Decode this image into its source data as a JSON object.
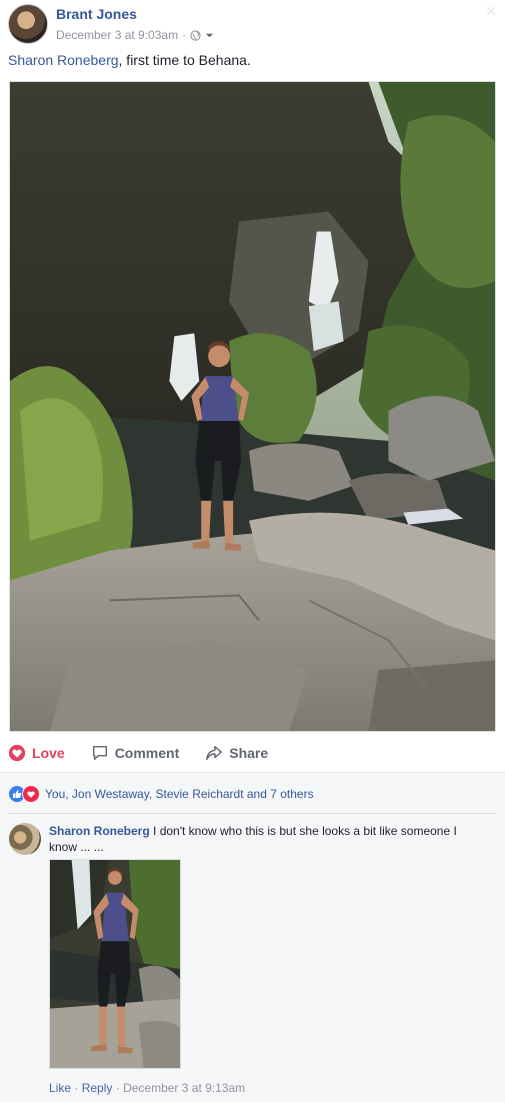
{
  "post": {
    "author": "Brant Jones",
    "timestamp": "December 3 at 9:03am",
    "separator": "·",
    "privacy_icon": "globe-icon",
    "caption_tag": "Sharon Roneberg",
    "caption_text": ", first time to Behana."
  },
  "actions": {
    "love_label": "Love",
    "comment_label": "Comment",
    "share_label": "Share"
  },
  "reactions": {
    "summary": "You, Jon Westaway, Stevie Reichardt and 7 others"
  },
  "comment": {
    "author": "Sharon Roneberg",
    "text": " I don't know who this is but she looks a bit like someone I know ... ...",
    "like_label": "Like",
    "reply_label": "Reply",
    "separator": "·",
    "timestamp": "December 3 at 9:13am"
  },
  "colors": {
    "link_blue": "#365899",
    "love_red": "#e5405e",
    "muted_gray": "#90949c",
    "like_blue": "#3b7fea"
  }
}
